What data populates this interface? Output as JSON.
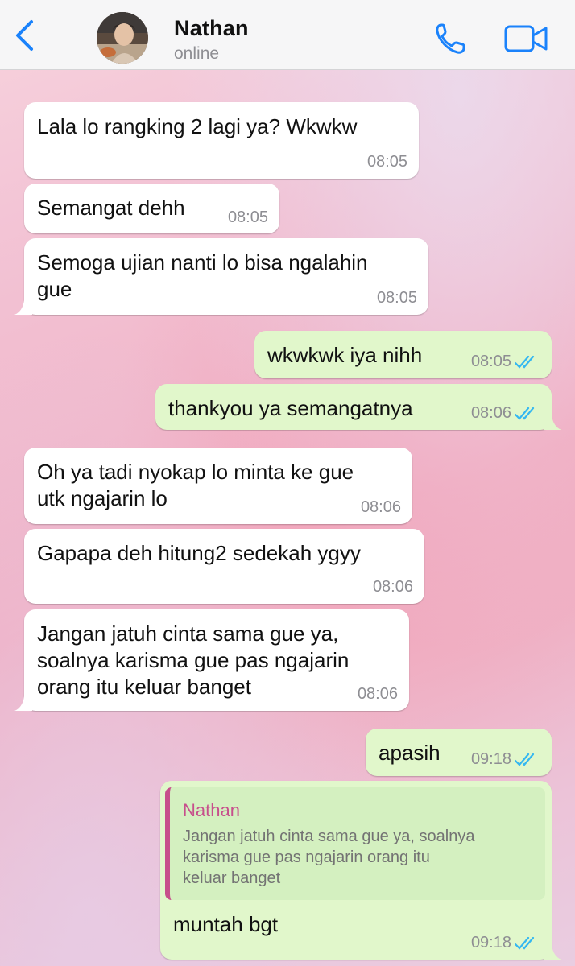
{
  "header": {
    "contact_name": "Nathan",
    "status": "online",
    "icons": {
      "back": "chevron-left-icon",
      "call": "phone-icon",
      "video": "video-camera-icon"
    },
    "accent_color": "#1a82fb"
  },
  "messages": [
    {
      "direction": "incoming",
      "text": "Lala lo rangking 2 lagi ya? Wkwkw",
      "time": "08:05"
    },
    {
      "direction": "incoming",
      "text": "Semangat dehh",
      "time": "08:05"
    },
    {
      "direction": "incoming",
      "text": "Semoga ujian nanti lo bisa ngalahin\ngue",
      "time": "08:05"
    },
    {
      "direction": "outgoing",
      "text": "wkwkwk iya nihh",
      "time": "08:05",
      "status": "read"
    },
    {
      "direction": "outgoing",
      "text": "thankyou ya semangatnya",
      "time": "08:06",
      "status": "read"
    },
    {
      "direction": "incoming",
      "text": "Oh ya tadi nyokap lo minta ke gue\nutk ngajarin lo",
      "time": "08:06"
    },
    {
      "direction": "incoming",
      "text": "Gapapa deh hitung2 sedekah ygyy",
      "time": "08:06"
    },
    {
      "direction": "incoming",
      "text": "Jangan jatuh cinta sama gue ya,\nsoalnya karisma gue pas ngajarin\norang itu keluar banget",
      "time": "08:06"
    },
    {
      "direction": "outgoing",
      "text": "apasih",
      "time": "09:18",
      "status": "read"
    },
    {
      "direction": "outgoing",
      "text": "muntah bgt",
      "time": "09:18",
      "status": "read",
      "quote": {
        "author": "Nathan",
        "text": "Jangan jatuh cinta sama gue ya, soalnya\nkarisma gue pas ngajarin orang itu\nkeluar banget"
      }
    }
  ],
  "colors": {
    "incoming_bubble": "#ffffff",
    "outgoing_bubble": "#e1f7cb",
    "read_ticks": "#34b7f1",
    "quote_author": "#c74f8c"
  }
}
